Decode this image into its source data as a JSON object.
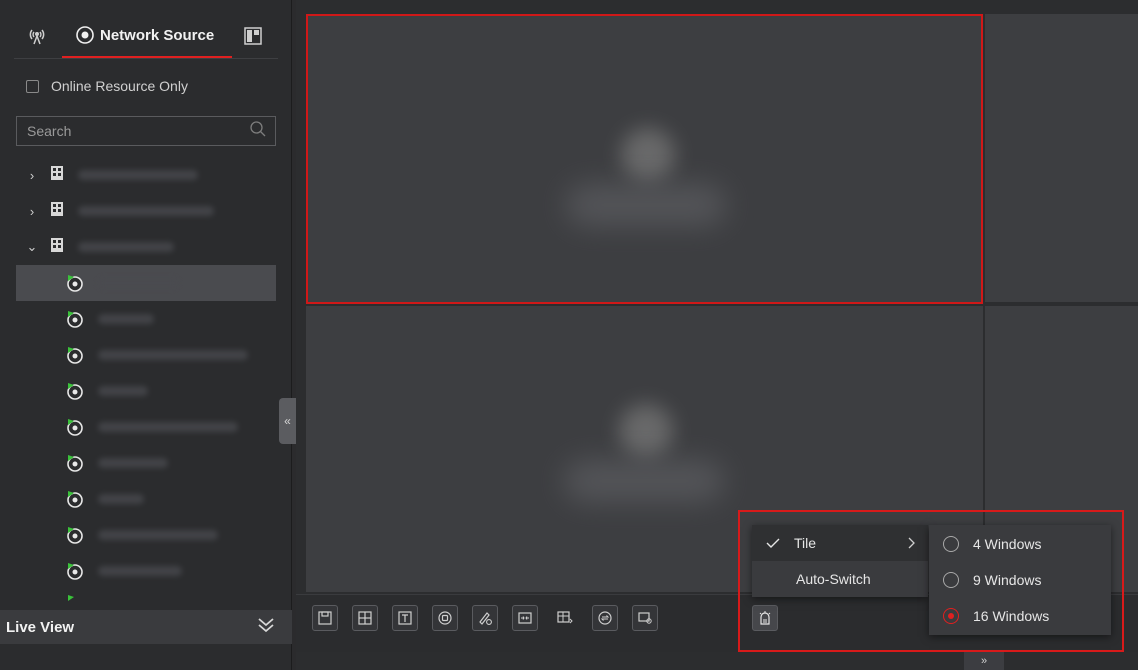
{
  "sidebar": {
    "tab_active_label": "Network Source",
    "online_resource_label": "Online Resource Only",
    "search_placeholder": "Search",
    "footer_label": "Live View",
    "collapse_glyph": "«"
  },
  "toolbar": {
    "buttons": [
      "save-icon",
      "grid-layout-icon",
      "text-overlay-icon",
      "record-icon",
      "draw-schedule-icon",
      "fit-window-icon",
      "grid-settings-icon",
      "switch-icon",
      "monitor-view-icon",
      "window-division-icon"
    ]
  },
  "menu": {
    "tile_label": "Tile",
    "auto_switch_label": "Auto-Switch"
  },
  "submenu": {
    "options": [
      {
        "label": "4 Windows",
        "selected": false
      },
      {
        "label": "9 Windows",
        "selected": false
      },
      {
        "label": "16 Windows",
        "selected": true
      }
    ]
  },
  "colors": {
    "accent": "#e02020",
    "online_green": "#3ac23a",
    "background": "#2b2c2e"
  },
  "bottom_toggle_glyph": "»"
}
